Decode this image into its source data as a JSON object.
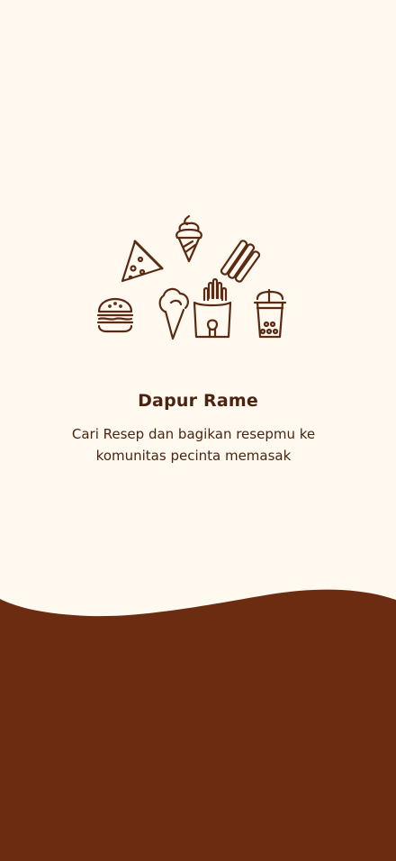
{
  "app": {
    "title": "Dapur Rame",
    "tagline": "Cari Resep dan bagikan resepmu ke komunitas pecinta memasak"
  },
  "illustration": {
    "icons": [
      "pizza-slice-icon",
      "soft-serve-cone-icon",
      "churros-icon",
      "burger-icon",
      "ice-cream-scoop-icon",
      "french-fries-icon",
      "bubble-tea-icon"
    ]
  },
  "colors": {
    "background": "#FFF9F0",
    "accent": "#6B2C11",
    "text": "#4A2411",
    "icon_stroke": "#5A2A12"
  }
}
